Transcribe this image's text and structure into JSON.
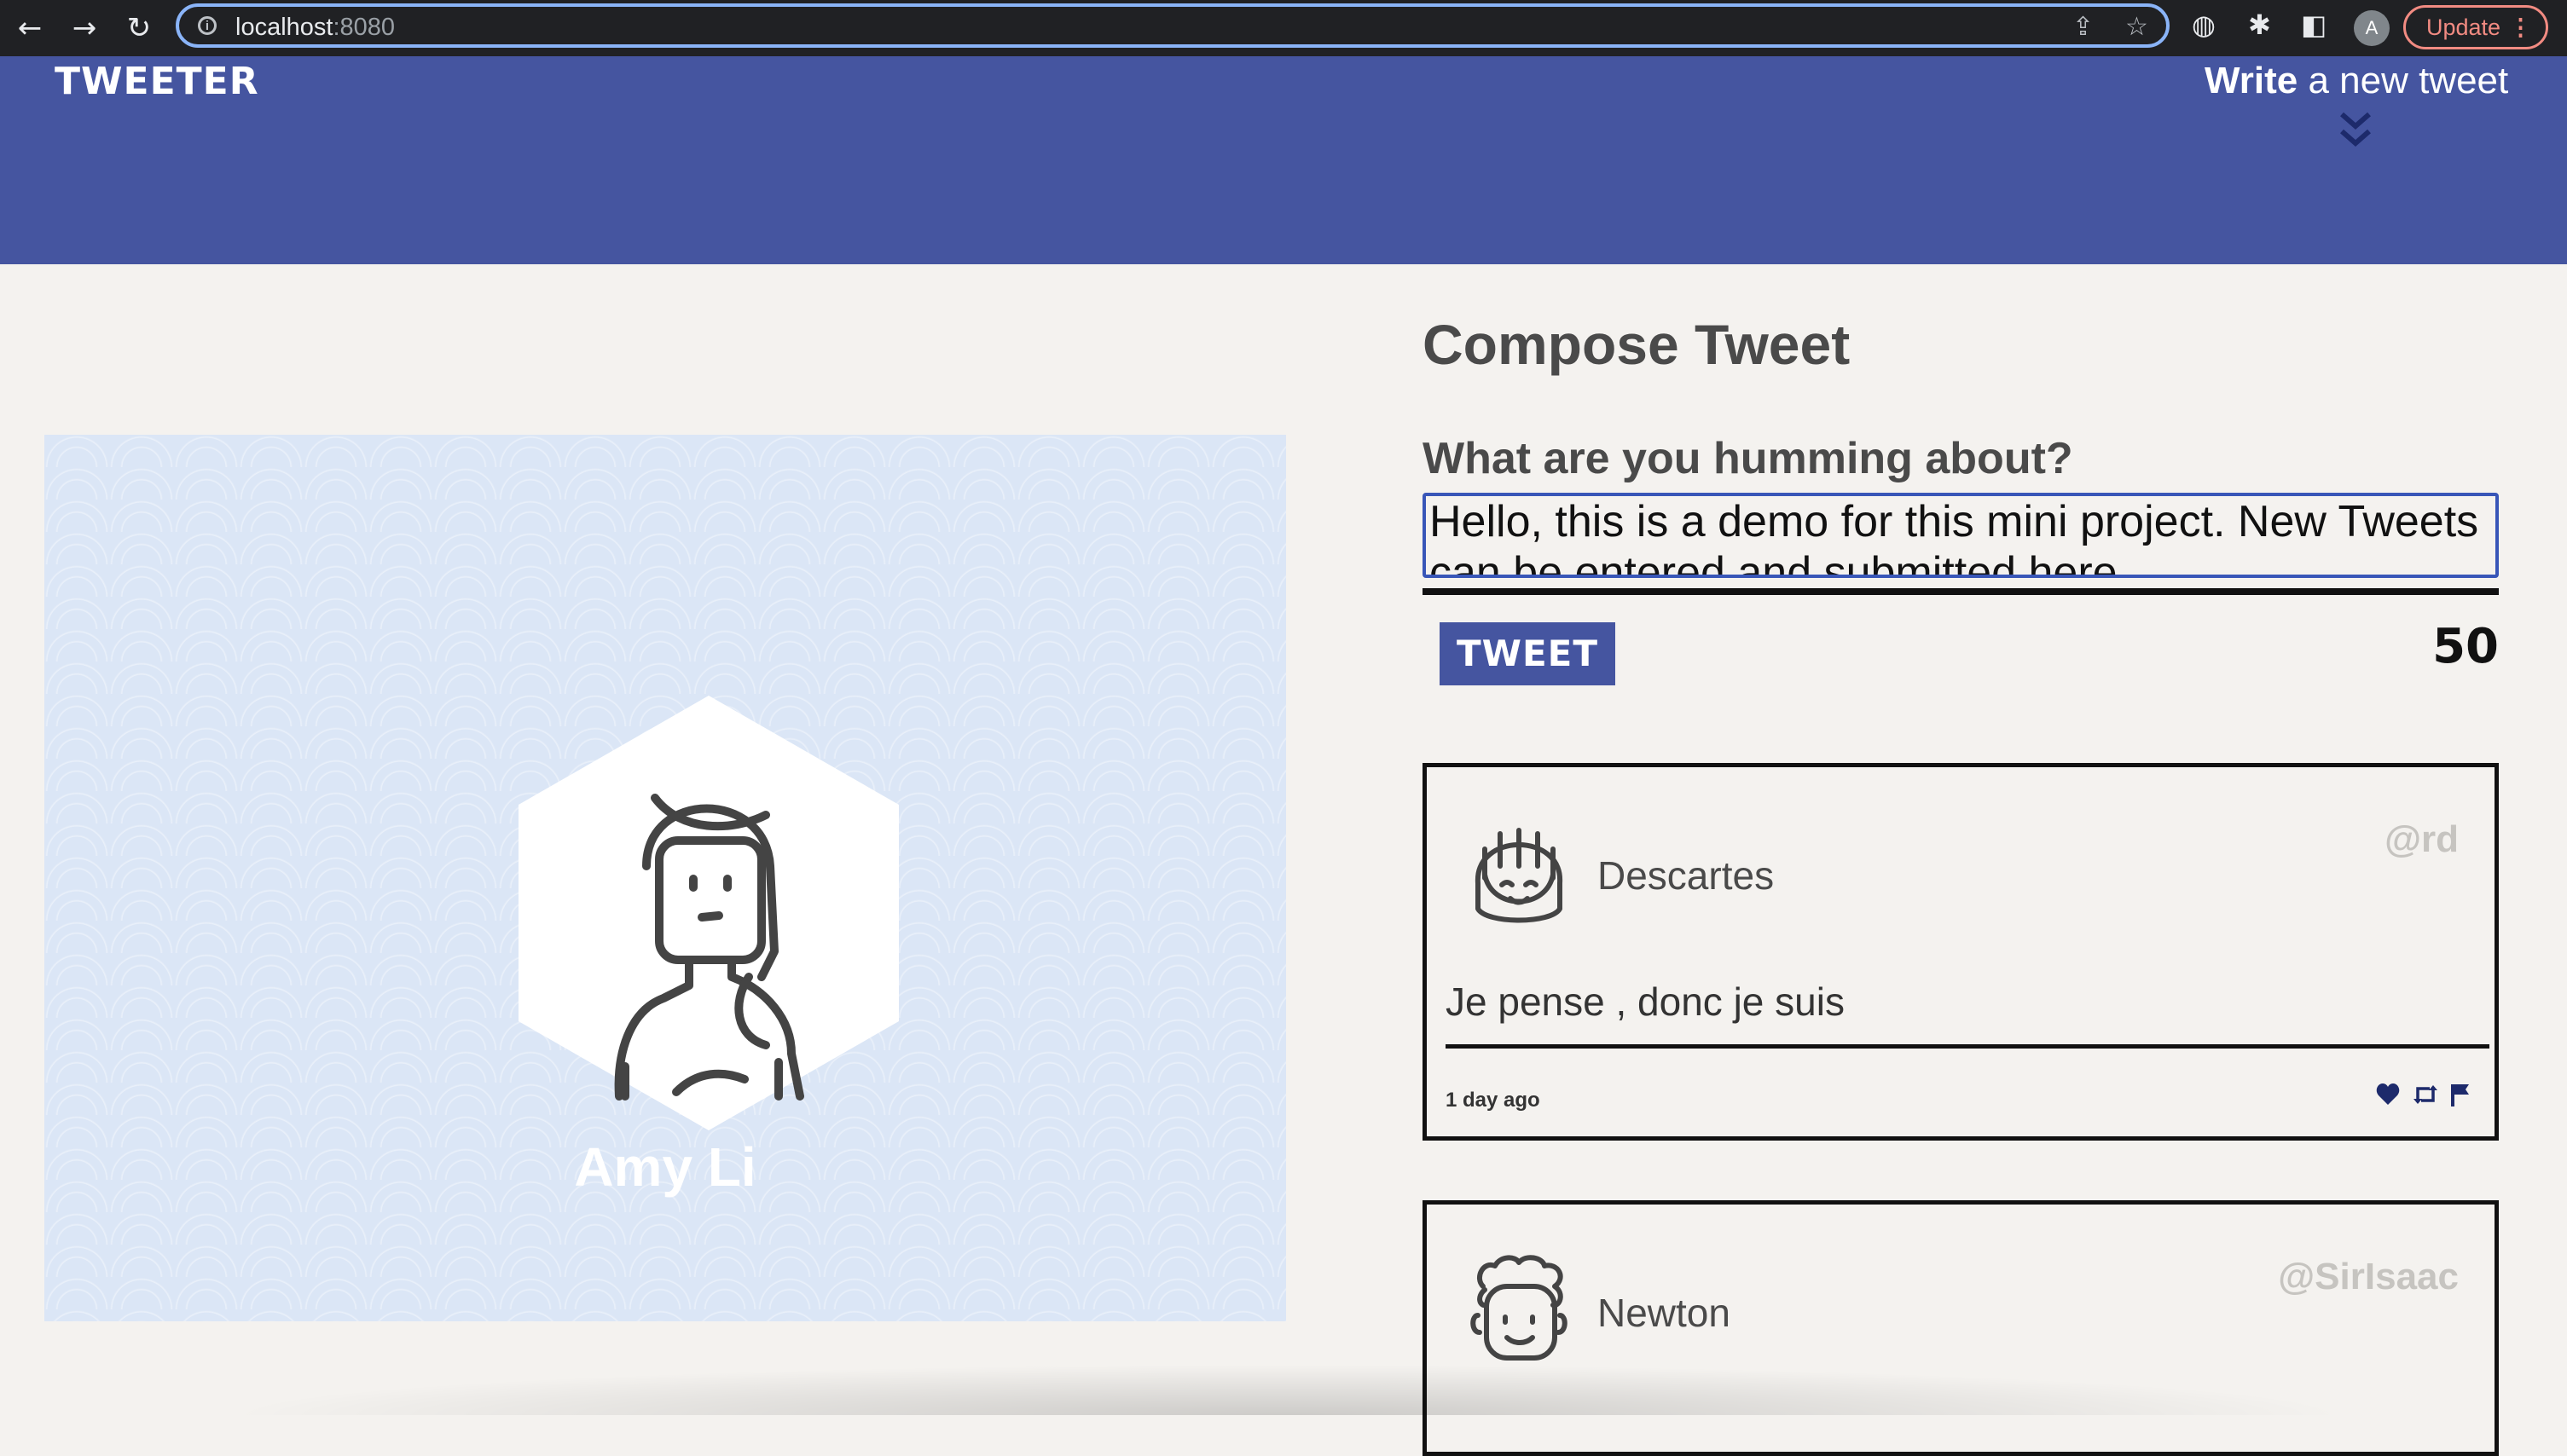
{
  "browser": {
    "url_host": "localhost",
    "url_port": ":8080",
    "update_label": "Update",
    "profile_initial": "A"
  },
  "header": {
    "brand": "TWEETER",
    "write_bold": "Write",
    "write_rest": " a new tweet"
  },
  "profile": {
    "name": "Amy Li"
  },
  "compose": {
    "title": "Compose Tweet",
    "label": "What are you humming about?",
    "text": "Hello, this is a demo for this mini project. New Tweets can be entered and submitted here.",
    "button_label": "TWEET",
    "counter": "50"
  },
  "tweets": [
    {
      "name": "Descartes",
      "handle": "@rd",
      "content": "Je pense , donc je suis",
      "time": "1 day ago"
    },
    {
      "name": "Newton",
      "handle": "@SirIsaac"
    }
  ],
  "colors": {
    "header_bg": "#4555a0",
    "page_bg": "#f4f2ef",
    "accent": "#3856b8"
  }
}
